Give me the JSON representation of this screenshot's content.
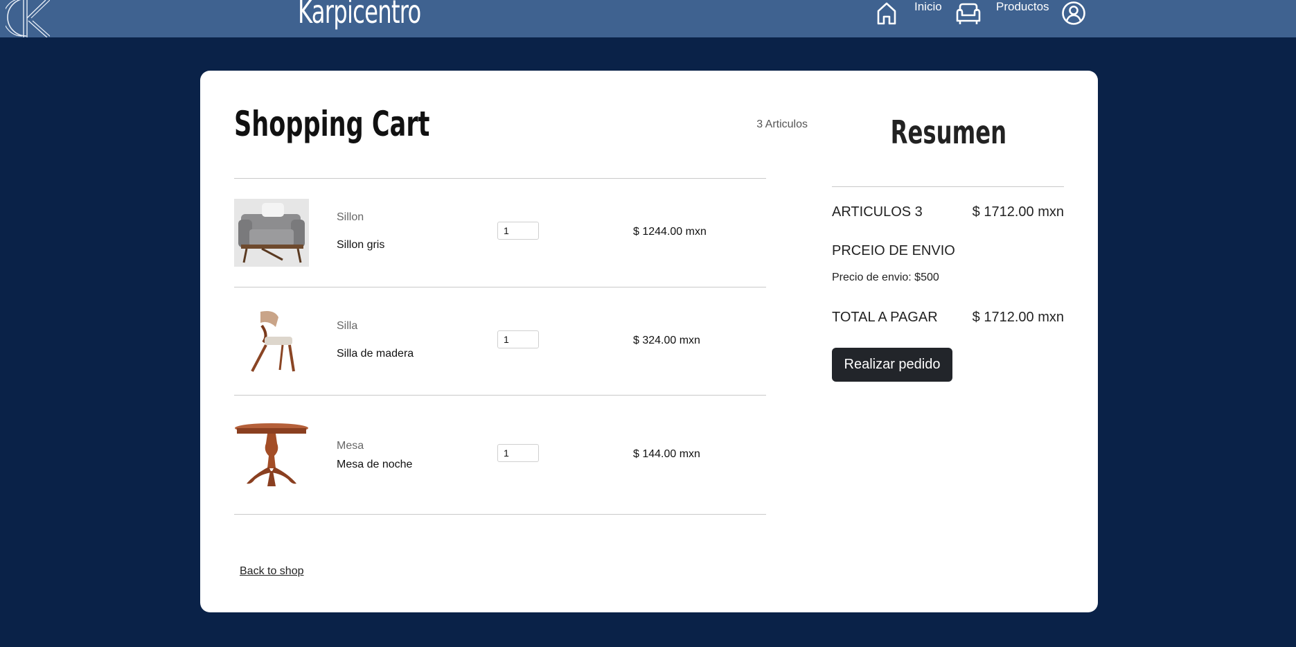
{
  "nav": {
    "brand": "Karpicentro",
    "links": [
      {
        "label": "Inicio",
        "icon": "home-icon"
      },
      {
        "label": "Productos",
        "icon": "sofa-icon"
      }
    ],
    "account_icon": "user-circle-icon"
  },
  "cart": {
    "title": "Shopping Cart",
    "count_label": "3 Articulos",
    "items": [
      {
        "category": "Sillon",
        "name": "Sillon gris",
        "qty": "1",
        "price": "$ 1244.00 mxn",
        "image": "armchair-image"
      },
      {
        "category": "Silla",
        "name": "Silla de madera",
        "qty": "1",
        "price": "$ 324.00 mxn",
        "image": "chair-image"
      },
      {
        "category": "Mesa",
        "name": "Mesa de noche",
        "qty": "1",
        "price": "$ 144.00 mxn",
        "image": "table-image"
      }
    ],
    "back_label": "Back to shop"
  },
  "summary": {
    "title": "Resumen",
    "articles_label": "ARTICULOS 3",
    "articles_value": "$ 1712.00 mxn",
    "shipping_label": "PRCEIO DE ENVIO",
    "shipping_note": "Precio de envio: $500",
    "total_label": "TOTAL A PAGAR",
    "total_value": "$ 1712.00 mxn",
    "order_button": "Realizar pedido"
  },
  "colors": {
    "background": "#0a2248",
    "navbar": "#3f6290",
    "card": "#ffffff",
    "button": "#22252a"
  }
}
